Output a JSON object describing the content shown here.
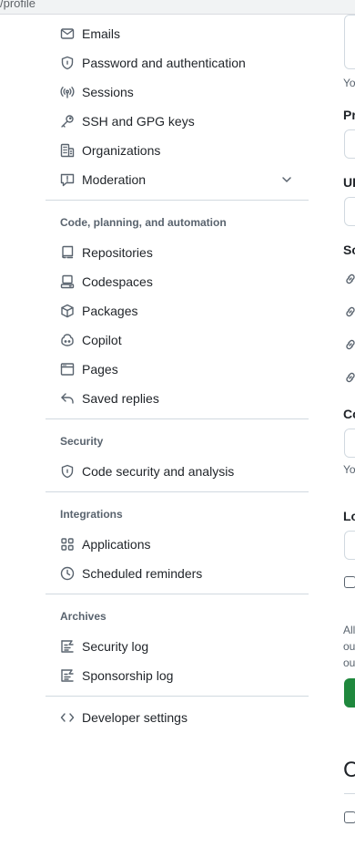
{
  "browser": {
    "url_fragment": "/profile"
  },
  "sidebar": {
    "top_items": [
      {
        "label": "Emails",
        "icon": "mail-icon"
      },
      {
        "label": "Password and authentication",
        "icon": "shield-lock-icon"
      },
      {
        "label": "Sessions",
        "icon": "broadcast-icon"
      },
      {
        "label": "SSH and GPG keys",
        "icon": "key-icon"
      },
      {
        "label": "Organizations",
        "icon": "organization-icon"
      },
      {
        "label": "Moderation",
        "icon": "report-icon",
        "expandable": true
      }
    ],
    "groups": [
      {
        "heading": "Code, planning, and automation",
        "items": [
          {
            "label": "Repositories",
            "icon": "repo-icon"
          },
          {
            "label": "Codespaces",
            "icon": "codespaces-icon"
          },
          {
            "label": "Packages",
            "icon": "package-icon"
          },
          {
            "label": "Copilot",
            "icon": "copilot-icon"
          },
          {
            "label": "Pages",
            "icon": "browser-icon"
          },
          {
            "label": "Saved replies",
            "icon": "reply-icon"
          }
        ]
      },
      {
        "heading": "Security",
        "items": [
          {
            "label": "Code security and analysis",
            "icon": "shield-lock-icon"
          }
        ]
      },
      {
        "heading": "Integrations",
        "items": [
          {
            "label": "Applications",
            "icon": "apps-icon"
          },
          {
            "label": "Scheduled reminders",
            "icon": "clock-icon"
          }
        ]
      },
      {
        "heading": "Archives",
        "items": [
          {
            "label": "Security log",
            "icon": "log-icon"
          },
          {
            "label": "Sponsorship log",
            "icon": "log-icon"
          }
        ]
      }
    ],
    "bottom_items": [
      {
        "label": "Developer settings",
        "icon": "code-icon"
      }
    ]
  },
  "right_panel": {
    "text_1": "Yo",
    "label_1": "Pr",
    "label_2": "UI",
    "label_3": "Sc",
    "label_4": "Co",
    "text_2": "Yo",
    "label_5": "Lo",
    "text_3": "All",
    "text_4": "ou",
    "text_5": "ou",
    "heading": "C"
  },
  "colors": {
    "accent_green": "#1f883d",
    "border": "#d1d9e0",
    "muted_text": "#59636e"
  }
}
